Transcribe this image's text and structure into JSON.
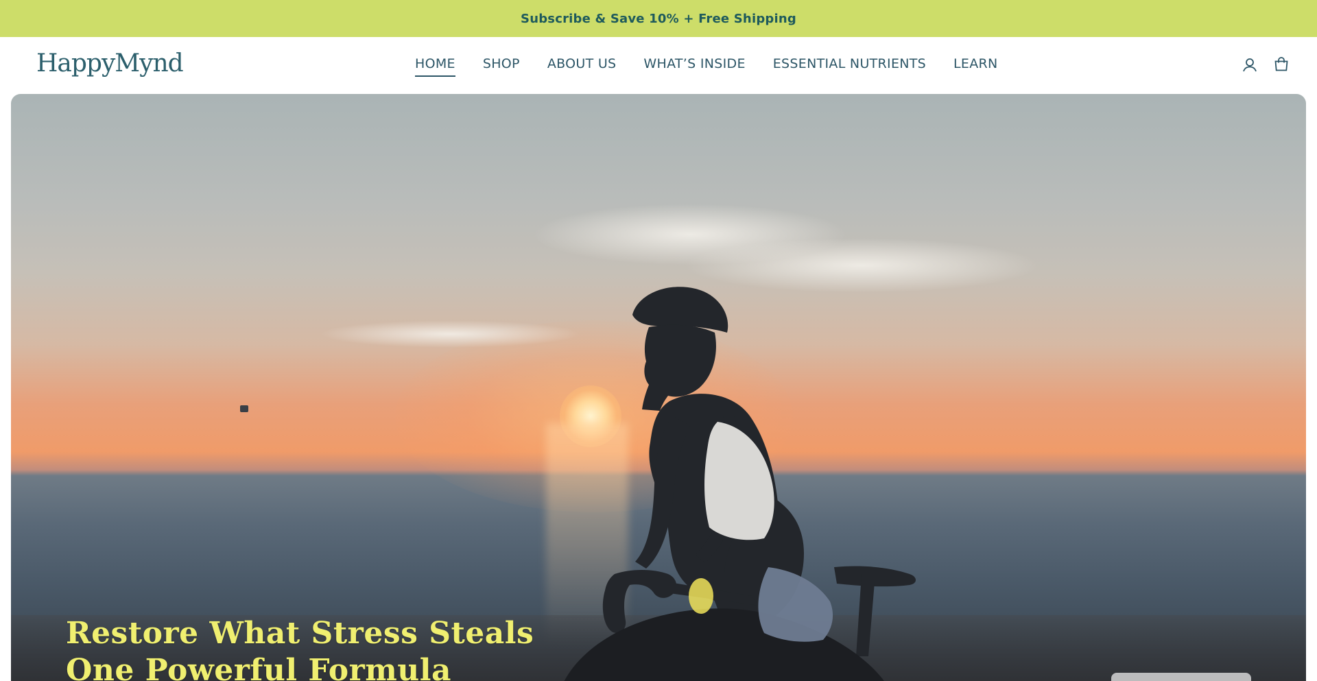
{
  "announcement": {
    "text": "Subscribe & Save 10% + Free Shipping"
  },
  "header": {
    "logo": "HappyMynd",
    "nav": [
      {
        "label": "HOME",
        "active": true
      },
      {
        "label": "SHOP",
        "active": false
      },
      {
        "label": "ABOUT US",
        "active": false
      },
      {
        "label": "WHAT’S INSIDE",
        "active": false
      },
      {
        "label": "ESSENTIAL NUTRIENTS",
        "active": false
      },
      {
        "label": "LEARN",
        "active": false
      }
    ],
    "icons": [
      "account-icon",
      "cart-icon"
    ]
  },
  "hero": {
    "title_line1": "Restore What Stress Steals",
    "title_line2": "One Powerful Formula"
  },
  "colors": {
    "announcement_bg": "#cddd69",
    "brand_teal": "#2c5f6c",
    "hero_title": "#f0ef70"
  }
}
